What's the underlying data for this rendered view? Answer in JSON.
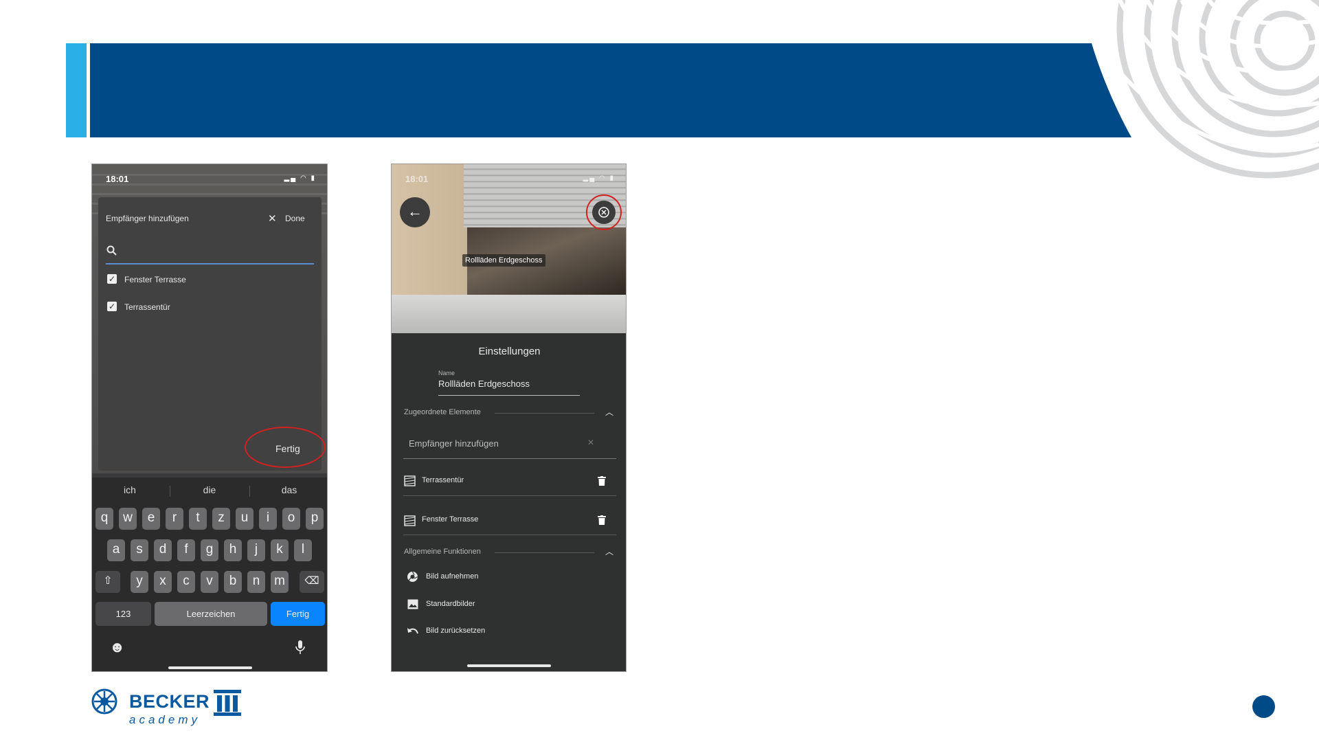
{
  "phone1": {
    "status_time": "18:01",
    "dialog_title": "Empfänger hinzufügen",
    "done_label": "Done",
    "items": [
      {
        "label": "Fenster Terrasse",
        "checked": true
      },
      {
        "label": "Terrassentür",
        "checked": true
      }
    ],
    "fertig_label": "Fertig",
    "suggestions": [
      "ich",
      "die",
      "das"
    ],
    "keyboard_row1": [
      "q",
      "w",
      "e",
      "r",
      "t",
      "z",
      "u",
      "i",
      "o",
      "p"
    ],
    "keyboard_row2": [
      "a",
      "s",
      "d",
      "f",
      "g",
      "h",
      "j",
      "k",
      "l"
    ],
    "keyboard_row3": [
      "y",
      "x",
      "c",
      "v",
      "b",
      "n",
      "m"
    ],
    "key_123": "123",
    "key_space": "Leerzeichen",
    "key_return": "Fertig"
  },
  "phone2": {
    "status_time": "18:01",
    "photo_label": "Rollläden Erdgeschoss",
    "settings_title": "Einstellungen",
    "name_caption": "Name",
    "name_value": "Rollläden Erdgeschoss",
    "section_assigned": "Zugeordnete Elemente",
    "add_recipient_placeholder": "Empfänger hinzufügen",
    "assigned_items": [
      "Terrassentür",
      "Fenster Terrasse"
    ],
    "section_general": "Allgemeine Funktionen",
    "functions": [
      "Bild aufnehmen",
      "Standardbilder",
      "Bild zurücksetzen"
    ]
  },
  "footer": {
    "brand": "BECKER",
    "brand_sub": "academy"
  },
  "colors": {
    "header_blue": "#004b87",
    "accent_cyan": "#29aee6",
    "highlight_red": "#d32020",
    "ios_blue": "#0a84ff"
  }
}
